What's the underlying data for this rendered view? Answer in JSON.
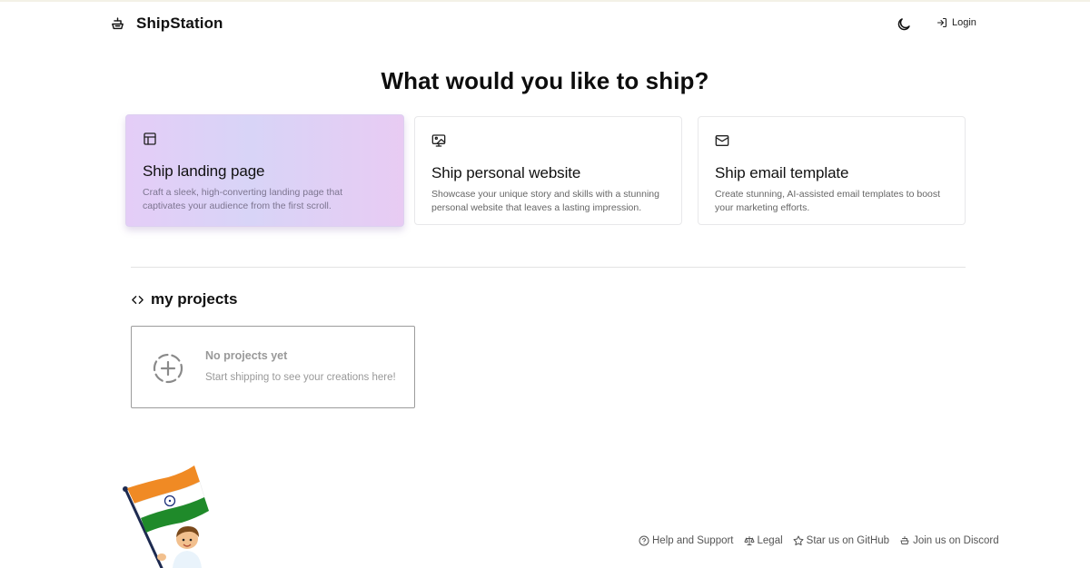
{
  "header": {
    "brand_name": "ShipStation",
    "login_label": "Login",
    "logo_icon": "ship-icon",
    "theme_icon": "moon-icon",
    "login_icon": "login-arrow-icon"
  },
  "hero": {
    "title": "What would you like to ship?"
  },
  "cards": [
    {
      "title": "Ship landing page",
      "description": "Craft a sleek, high-converting landing page that captivates your audience from the first scroll.",
      "icon": "layout-icon",
      "selected": true
    },
    {
      "title": "Ship personal website",
      "description": "Showcase your unique story and skills with a stunning personal website that leaves a lasting impression.",
      "icon": "monitor-image-icon",
      "selected": false
    },
    {
      "title": "Ship email template",
      "description": "Create stunning, AI-assisted email templates to boost your marketing efforts.",
      "icon": "mail-icon",
      "selected": false
    }
  ],
  "projects": {
    "heading": "my projects",
    "empty_title": "No projects yet",
    "empty_subtitle": "Start shipping to see your creations here!"
  },
  "footer": {
    "links": [
      {
        "label": "Help and Support",
        "icon": "help-circle-icon"
      },
      {
        "label": "Legal",
        "icon": "scale-icon"
      },
      {
        "label": "Star us on GitHub",
        "icon": "star-icon"
      },
      {
        "label": "Join us on Discord",
        "icon": "discord-icon"
      }
    ]
  },
  "colors": {
    "selected_card_gradient": [
      "#e4cdf7",
      "#d8d4f7",
      "#e8cbf3"
    ],
    "flag_saffron": "#f08a24",
    "flag_green": "#1f8a2a",
    "flag_chakra": "#1c2f7a"
  }
}
